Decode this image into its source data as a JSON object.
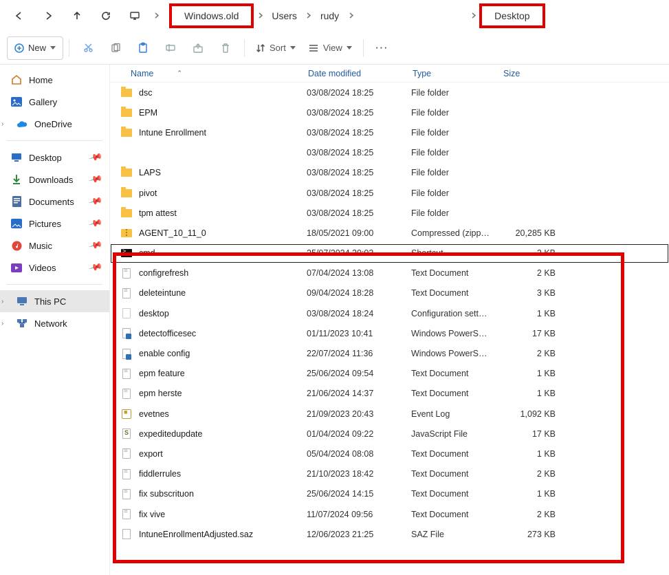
{
  "breadcrumb": [
    "Windows.old",
    "Users",
    "rudy",
    "Desktop"
  ],
  "breadcrumb_highlight": [
    0,
    3
  ],
  "toolbar": {
    "new_label": "New",
    "sort_label": "Sort",
    "view_label": "View"
  },
  "sidebar": {
    "top": [
      {
        "label": "Home",
        "icon": "home"
      },
      {
        "label": "Gallery",
        "icon": "gallery"
      },
      {
        "label": "OneDrive",
        "icon": "onedrive",
        "expandable": true
      }
    ],
    "quick": [
      {
        "label": "Desktop",
        "icon": "desktop",
        "pinned": true
      },
      {
        "label": "Downloads",
        "icon": "downloads",
        "pinned": true
      },
      {
        "label": "Documents",
        "icon": "documents",
        "pinned": true
      },
      {
        "label": "Pictures",
        "icon": "pictures",
        "pinned": true
      },
      {
        "label": "Music",
        "icon": "music",
        "pinned": true
      },
      {
        "label": "Videos",
        "icon": "videos",
        "pinned": true
      }
    ],
    "system": [
      {
        "label": "This PC",
        "icon": "thispc",
        "expandable": true,
        "selected": true
      },
      {
        "label": "Network",
        "icon": "network",
        "expandable": true
      }
    ]
  },
  "columns": {
    "name": "Name",
    "date": "Date modified",
    "type": "Type",
    "size": "Size"
  },
  "files": [
    {
      "name": "dsc",
      "date": "03/08/2024 18:25",
      "type": "File folder",
      "size": "",
      "icon": "folder"
    },
    {
      "name": "EPM",
      "date": "03/08/2024 18:25",
      "type": "File folder",
      "size": "",
      "icon": "folder"
    },
    {
      "name": "Intune Enrollment",
      "date": "03/08/2024 18:25",
      "type": "File folder",
      "size": "",
      "icon": "folder"
    },
    {
      "name": "",
      "date": "03/08/2024 18:25",
      "type": "File folder",
      "size": "",
      "icon": "none"
    },
    {
      "name": "LAPS",
      "date": "03/08/2024 18:25",
      "type": "File folder",
      "size": "",
      "icon": "folder"
    },
    {
      "name": "pivot",
      "date": "03/08/2024 18:25",
      "type": "File folder",
      "size": "",
      "icon": "folder"
    },
    {
      "name": "tpm attest",
      "date": "03/08/2024 18:25",
      "type": "File folder",
      "size": "",
      "icon": "folder"
    },
    {
      "name": "AGENT_10_11_0",
      "date": "18/05/2021 09:00",
      "type": "Compressed (zipp…",
      "size": "20,285 KB",
      "icon": "zip"
    },
    {
      "name": "cmd",
      "date": "25/07/2024 20:03",
      "type": "Shortcut",
      "size": "2 KB",
      "icon": "cmd",
      "selected": true
    },
    {
      "name": "configrefresh",
      "date": "07/04/2024 13:08",
      "type": "Text Document",
      "size": "2 KB",
      "icon": "txt"
    },
    {
      "name": "deleteintune",
      "date": "09/04/2024 18:28",
      "type": "Text Document",
      "size": "3 KB",
      "icon": "txt"
    },
    {
      "name": "desktop",
      "date": "03/08/2024 18:24",
      "type": "Configuration sett…",
      "size": "1 KB",
      "icon": "ini"
    },
    {
      "name": "detectofficesec",
      "date": "01/11/2023 10:41",
      "type": "Windows PowerS…",
      "size": "17 KB",
      "icon": "ps"
    },
    {
      "name": "enable    config",
      "date": "22/07/2024 11:36",
      "type": "Windows PowerS…",
      "size": "2 KB",
      "icon": "ps"
    },
    {
      "name": "epm feature",
      "date": "25/06/2024 09:54",
      "type": "Text Document",
      "size": "1 KB",
      "icon": "txt"
    },
    {
      "name": "epm herste",
      "date": "21/06/2024 14:37",
      "type": "Text Document",
      "size": "1 KB",
      "icon": "txt"
    },
    {
      "name": "evetnes",
      "date": "21/09/2023 20:43",
      "type": "Event Log",
      "size": "1,092 KB",
      "icon": "evlog"
    },
    {
      "name": "expeditedupdate",
      "date": "01/04/2024 09:22",
      "type": "JavaScript File",
      "size": "17 KB",
      "icon": "js"
    },
    {
      "name": "export",
      "date": "05/04/2024 08:08",
      "type": "Text Document",
      "size": "1 KB",
      "icon": "txt"
    },
    {
      "name": "fiddlerrules",
      "date": "21/10/2023 18:42",
      "type": "Text Document",
      "size": "2 KB",
      "icon": "txt"
    },
    {
      "name": "fix subscrituon",
      "date": "25/06/2024 14:15",
      "type": "Text Document",
      "size": "1 KB",
      "icon": "txt"
    },
    {
      "name": "fix vive",
      "date": "11/07/2024 09:56",
      "type": "Text Document",
      "size": "2 KB",
      "icon": "txt"
    },
    {
      "name": "IntuneEnrollmentAdjusted.saz",
      "date": "12/06/2023 21:25",
      "type": "SAZ File",
      "size": "273 KB",
      "icon": "saz"
    }
  ]
}
